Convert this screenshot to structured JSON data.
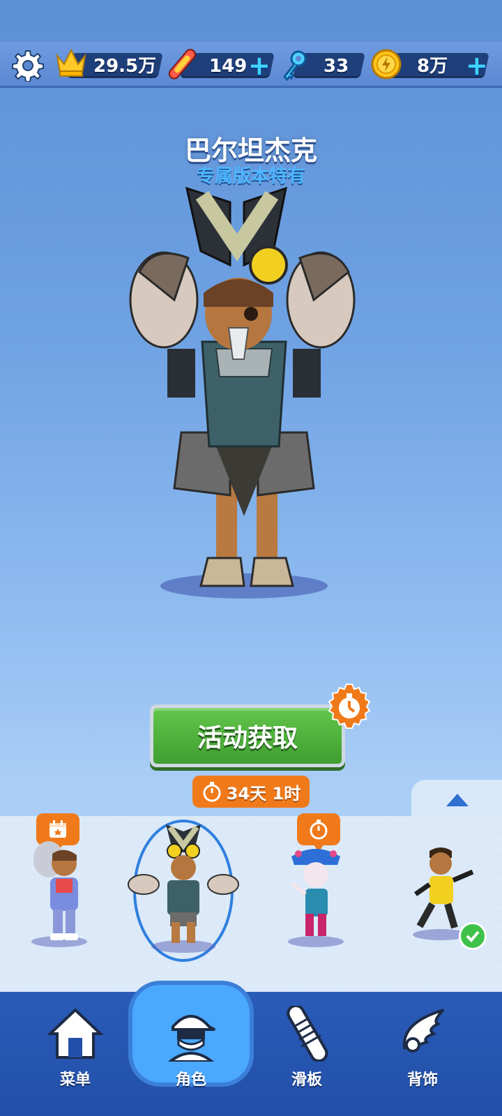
{
  "resources": {
    "crown_value": "29.5万",
    "hoverboard_value": "149",
    "key_value": "33",
    "coin_value": "8万"
  },
  "character": {
    "name": "巴尔坦杰克",
    "subtitle": "专属版本特有"
  },
  "action": {
    "button_label": "活动获取",
    "timer": "34天 1时"
  },
  "nav": {
    "items": [
      {
        "label": "菜单",
        "icon": "home-icon"
      },
      {
        "label": "角色",
        "icon": "character-icon"
      },
      {
        "label": "滑板",
        "icon": "hoverboard-icon"
      },
      {
        "label": "背饰",
        "icon": "wings-icon"
      }
    ],
    "active_index": 1
  },
  "colors": {
    "accent_orange": "#f07a1a",
    "button_green": "#4fb23a",
    "nav_blue": "#2654ad"
  }
}
